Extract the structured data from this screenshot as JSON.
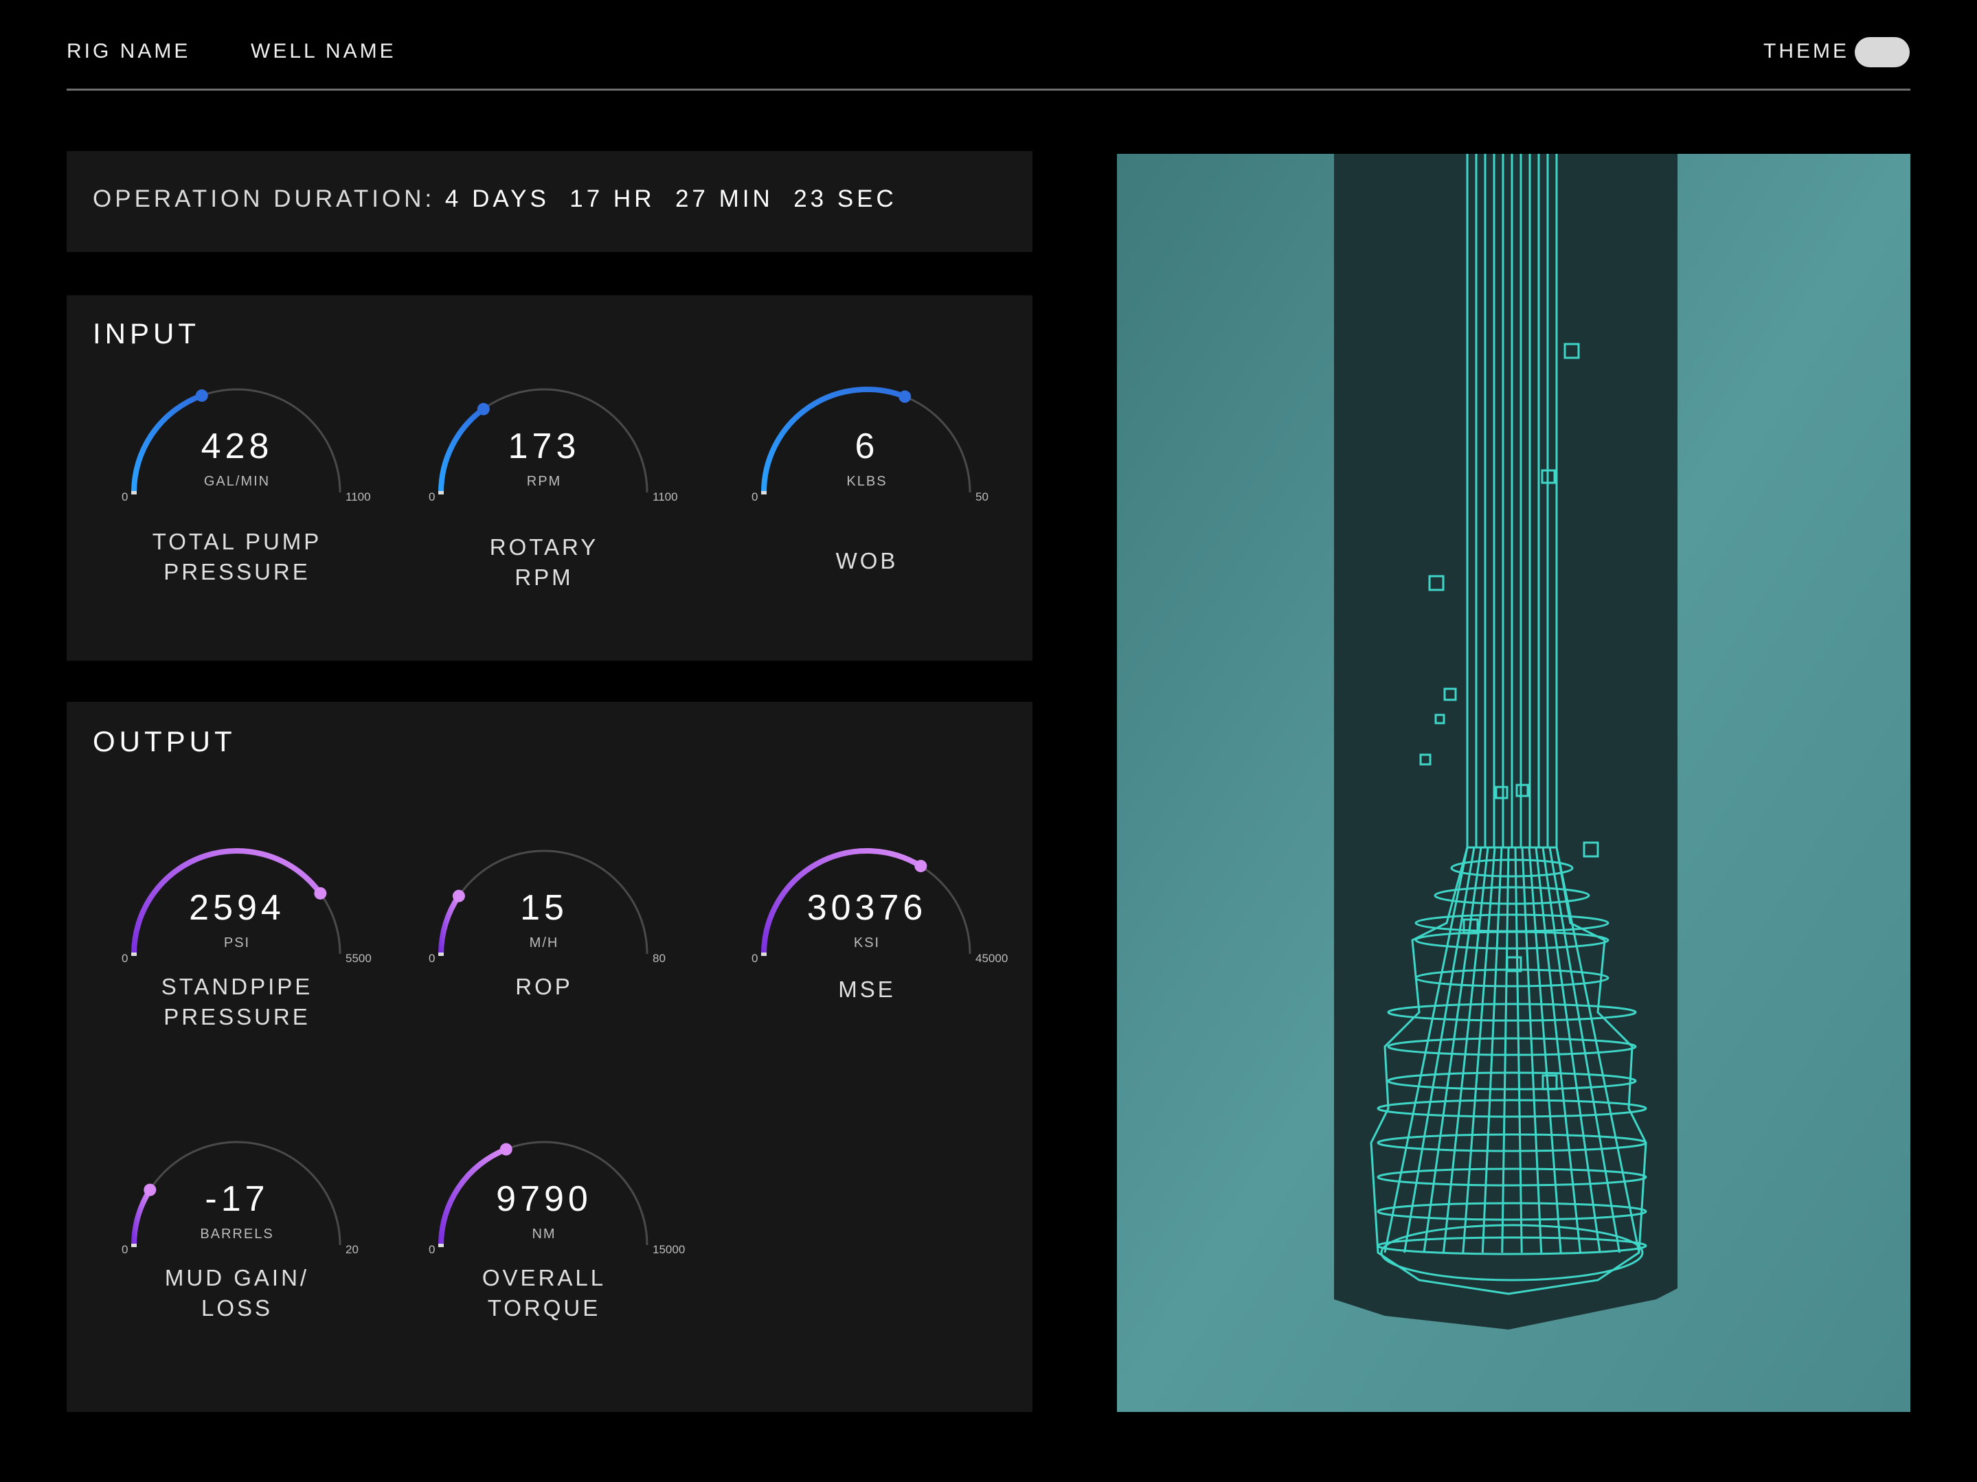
{
  "header": {
    "rig_name": "RIG NAME",
    "well_name": "WELL NAME",
    "theme_label": "THEME"
  },
  "duration": {
    "label": "OPERATION DURATION:",
    "days": "4 DAYS",
    "hours": "17 HR",
    "minutes": "27 MIN",
    "seconds": "23 SEC"
  },
  "input": {
    "title": "INPUT",
    "gauges": [
      {
        "value": "428",
        "unit": "GAL/MIN",
        "min": "0",
        "max": "1100",
        "fraction": 0.389,
        "label": [
          "TOTAL PUMP",
          "PRESSURE"
        ]
      },
      {
        "value": "173",
        "unit": "RPM",
        "min": "0",
        "max": "1100",
        "fraction": 0.3,
        "label": [
          "ROTARY",
          "RPM"
        ]
      },
      {
        "value": "6",
        "unit": "KLBS",
        "min": "0",
        "max": "50",
        "fraction": 0.62,
        "label": [
          "WOB"
        ]
      }
    ]
  },
  "output": {
    "title": "OUTPUT",
    "gauges": [
      {
        "value": "2594",
        "unit": "PSI",
        "min": "0",
        "max": "5500",
        "fraction": 0.8,
        "label": [
          "STANDPIPE",
          "PRESSURE"
        ]
      },
      {
        "value": "15",
        "unit": "M/H",
        "min": "0",
        "max": "80",
        "fraction": 0.19,
        "label": [
          "ROP"
        ]
      },
      {
        "value": "30376",
        "unit": "KSI",
        "min": "0",
        "max": "45000",
        "fraction": 0.675,
        "label": [
          "MSE"
        ]
      },
      {
        "value": "-17",
        "unit": "BARRELS",
        "min": "0",
        "max": "20",
        "fraction": 0.18,
        "label": [
          "MUD GAIN/",
          "LOSS"
        ]
      },
      {
        "value": "9790",
        "unit": "NM",
        "min": "0",
        "max": "15000",
        "fraction": 0.38,
        "label": [
          "OVERALL",
          "TORQUE"
        ]
      }
    ]
  },
  "colors": {
    "input_arc_start": "#2aa0ff",
    "input_arc_end": "#2f6fe0",
    "output_arc_start": "#7b2fe0",
    "output_arc_end": "#d98cf5",
    "track": "#4a4a4a",
    "panel": "#171717",
    "viz_bg": "#4c8a8c",
    "viz_wire": "#3fd6c8"
  }
}
